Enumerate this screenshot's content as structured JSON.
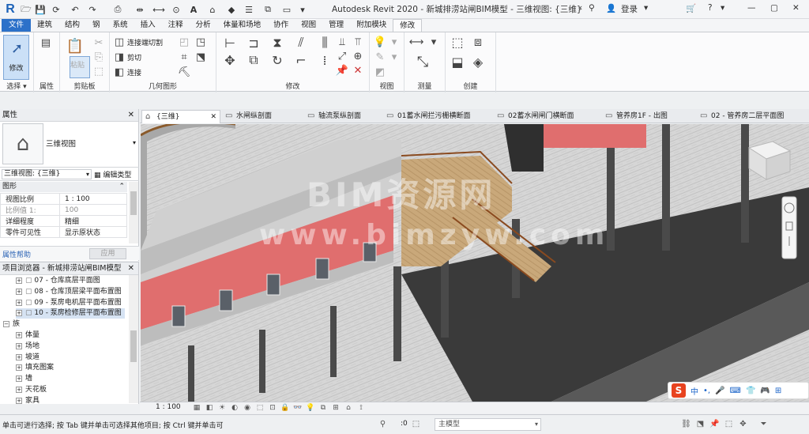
{
  "app": {
    "logo": "R",
    "title": "Autodesk Revit 2020 - 新城排涝站闸BIM模型 - 三维视图: {三维}",
    "login_label": "登录"
  },
  "ribbon_tabs": [
    "文件",
    "建筑",
    "结构",
    "钢",
    "系统",
    "插入",
    "注释",
    "分析",
    "体量和场地",
    "协作",
    "视图",
    "管理",
    "附加模块",
    "修改"
  ],
  "ribbon": {
    "select_panel": {
      "modify_label": "修改",
      "label": "选择 ▾"
    },
    "properties_panel": {
      "label": "属性"
    },
    "clipboard_panel": {
      "paste_label": "粘贴",
      "label": "剪贴板"
    },
    "geometry_panel": {
      "cope_label": "连接端切割",
      "cut_label": "剪切",
      "join_label": "连接",
      "label": "几何图形"
    },
    "modify_panel": {
      "label": "修改"
    },
    "view_panel": {
      "label": "视图"
    },
    "measure_panel": {
      "label": "测量"
    },
    "create_panel": {
      "label": "创建"
    }
  },
  "properties": {
    "title": "属性",
    "type_name": "三维视图",
    "instance_select": "三维视图: {三维}",
    "edit_type_label": "编辑类型",
    "group_graphics": "图形",
    "rows": [
      {
        "name": "视图比例",
        "value": "1 : 100",
        "dim": false
      },
      {
        "name": "比例值 1:",
        "value": "100",
        "dim": true
      },
      {
        "name": "详细程度",
        "value": "精细",
        "dim": false
      },
      {
        "name": "零件可见性",
        "value": "显示原状态",
        "dim": false
      }
    ],
    "help_link": "属性帮助",
    "apply_label": "应用"
  },
  "project_browser": {
    "title": "项目浏览器 - 新城排涝站闸BIM模型",
    "items": [
      {
        "label": "07 - 仓库底层平面图",
        "level": 2,
        "selected": false
      },
      {
        "label": "08 - 仓库顶层梁平面布置图",
        "level": 2,
        "selected": false
      },
      {
        "label": "09 - 泵房电机层平面布置图",
        "level": 2,
        "selected": false
      },
      {
        "label": "10 - 泵房检修层平面布置图",
        "level": 2,
        "selected": true
      },
      {
        "label": "族",
        "level": 0,
        "selected": false
      },
      {
        "label": "体量",
        "level": 1,
        "selected": false
      },
      {
        "label": "场地",
        "level": 1,
        "selected": false
      },
      {
        "label": "坡道",
        "level": 1,
        "selected": false
      },
      {
        "label": "填充图案",
        "level": 1,
        "selected": false
      },
      {
        "label": "墙",
        "level": 1,
        "selected": false
      },
      {
        "label": "天花板",
        "level": 1,
        "selected": false
      },
      {
        "label": "家具",
        "level": 1,
        "selected": false
      }
    ]
  },
  "view_tabs": [
    {
      "label": "{三维}",
      "active": true
    },
    {
      "label": "水闸纵剖面",
      "active": false
    },
    {
      "label": "轴流泵纵剖面",
      "active": false
    },
    {
      "label": "01蓄水闸拦污栅横断面",
      "active": false
    },
    {
      "label": "02蓄水闸闸门横断面",
      "active": false
    },
    {
      "label": "管养房1F - 出图",
      "active": false
    },
    {
      "label": "02 - 管养房二层平面图",
      "active": false
    }
  ],
  "viewport": {
    "watermark_line1": "BIM资源网",
    "watermark_line2": "www.bimzyw.com"
  },
  "ime": {
    "logo": "S",
    "mode": "中"
  },
  "view_controls": {
    "scale": "1 : 100"
  },
  "status": {
    "text": "单击可进行选择; 按 Tab 键并单击可选择其他项目; 按 Ctrl 键并单击可",
    "zero": ":0",
    "model_select": "主模型"
  },
  "colors": {
    "file_tab": "#2c71c9",
    "accent_blue": "#1d62b8",
    "wall_red": "#e06e6e",
    "stair_wood": "#c9a87a"
  }
}
